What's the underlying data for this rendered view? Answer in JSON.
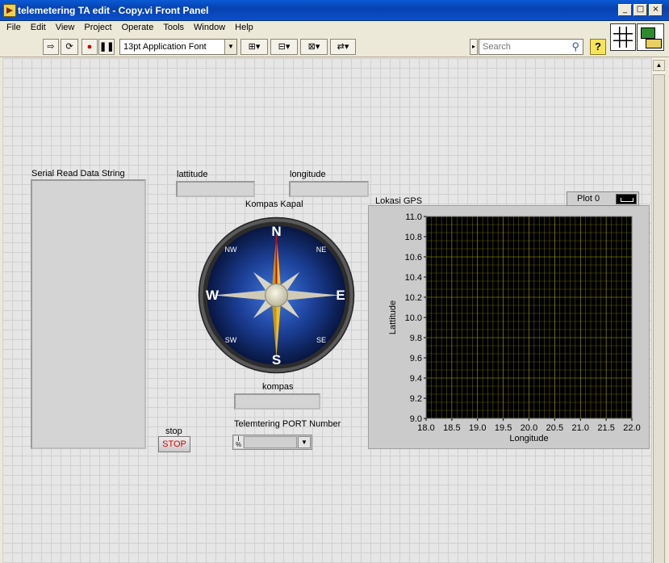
{
  "window": {
    "title": "telemetering TA edit - Copy.vi Front Panel"
  },
  "menu": [
    "File",
    "Edit",
    "View",
    "Project",
    "Operate",
    "Tools",
    "Window",
    "Help"
  ],
  "toolbar": {
    "font": "13pt Application Font",
    "search_placeholder": "Search"
  },
  "controls": {
    "serial_label": "Serial Read Data String",
    "lat_label": "lattitude",
    "lon_label": "longitude",
    "compass_label": "Kompas Kapal",
    "kompas_label": "kompas",
    "stop_label": "stop",
    "stop_button": "STOP",
    "port_label": "Telemtering PORT Number"
  },
  "compass": {
    "cardinals": [
      "N",
      "E",
      "S",
      "W"
    ],
    "intercardinals": [
      "NE",
      "SE",
      "SW",
      "NW"
    ]
  },
  "graph": {
    "label": "Lokasi GPS",
    "legend_name": "Plot 0",
    "plot_bg": "#000000",
    "grid_color": "#c8c800"
  },
  "chart_data": {
    "type": "scatter",
    "title": "Lokasi GPS",
    "xlabel": "Longitude",
    "ylabel": "Lattitude",
    "xlim": [
      18.0,
      22.0
    ],
    "ylim": [
      9.0,
      11.0
    ],
    "x_ticks": [
      "18.0",
      "18.5",
      "19.0",
      "19.5",
      "20.0",
      "20.5",
      "21.0",
      "21.5",
      "22.0"
    ],
    "y_ticks": [
      "9.0",
      "9.2",
      "9.4",
      "9.6",
      "9.8",
      "10.0",
      "10.2",
      "10.4",
      "10.6",
      "10.8",
      "11.0"
    ],
    "grid": true,
    "legend_position": "top-right",
    "series": [
      {
        "name": "Plot 0",
        "x": [],
        "y": []
      }
    ]
  }
}
